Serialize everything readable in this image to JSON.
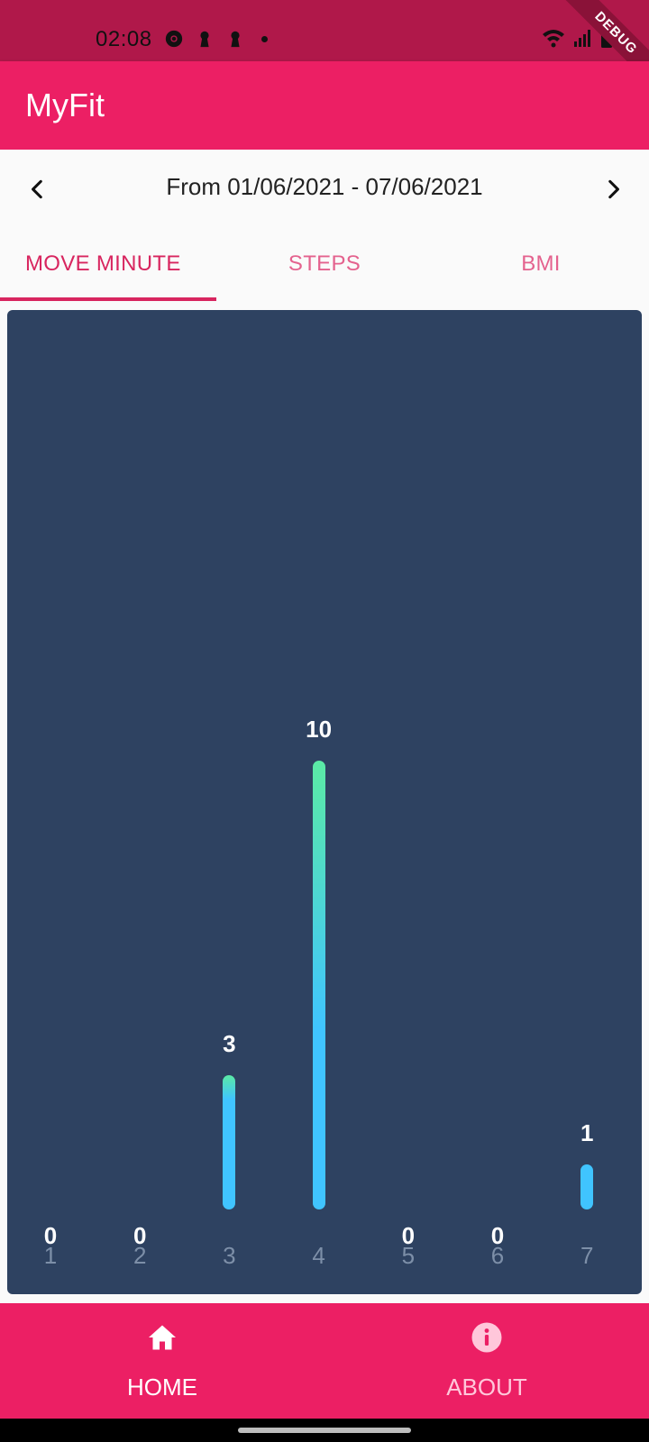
{
  "status_bar": {
    "time": "02:08",
    "debug_label": "DEBUG"
  },
  "app_bar": {
    "title": "MyFit"
  },
  "date_nav": {
    "label": "From 01/06/2021 - 07/06/2021",
    "prev_icon": "chevron-left-icon",
    "next_icon": "chevron-right-icon"
  },
  "tabs": [
    {
      "label": "MOVE MINUTE",
      "selected": true
    },
    {
      "label": "STEPS",
      "selected": false
    },
    {
      "label": "BMI",
      "selected": false
    }
  ],
  "chart_data": {
    "type": "bar",
    "categories": [
      "1",
      "2",
      "3",
      "4",
      "5",
      "6",
      "7"
    ],
    "values": [
      0,
      0,
      3,
      10,
      0,
      0,
      1
    ],
    "colors": {
      "bottom": "#40C4FF",
      "top": "#5BEAA5",
      "background": "#2E4261"
    }
  },
  "bottom_nav": {
    "home": {
      "label": "HOME",
      "icon": "home-icon",
      "active": true
    },
    "about": {
      "label": "ABOUT",
      "icon": "info-icon",
      "active": false
    }
  },
  "colors": {
    "primary": "#EC1F64",
    "status_bar": "#B0184A",
    "tab_active": "#D8255F",
    "tab_inactive": "#E4628E"
  }
}
